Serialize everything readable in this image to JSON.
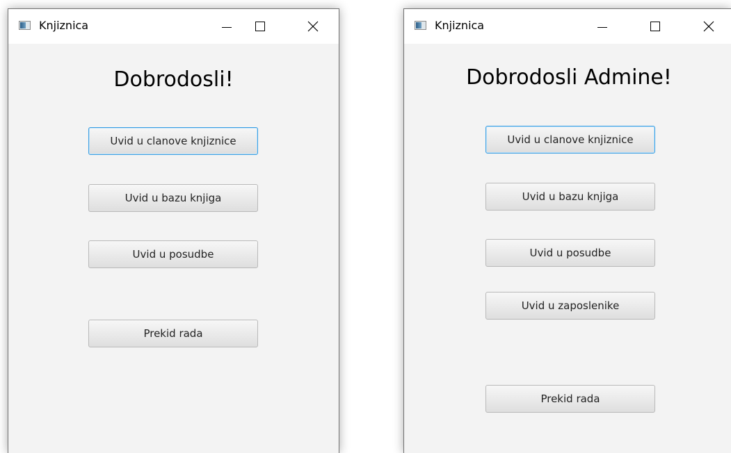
{
  "window_left": {
    "title": "Knjiznica",
    "heading": "Dobrodosli!",
    "buttons": [
      "Uvid u clanove knjiznice",
      "Uvid u bazu knjiga",
      "Uvid u posudbe",
      "Prekid rada"
    ]
  },
  "window_right": {
    "title": "Knjiznica",
    "heading": "Dobrodosli Admine!",
    "buttons": [
      "Uvid u clanove knjiznice",
      "Uvid u bazu knjiga",
      "Uvid u posudbe",
      "Uvid u zaposlenike",
      "Prekid rada"
    ]
  },
  "icons": {
    "app": "app-window-icon",
    "minimize": "minimize-icon",
    "maximize": "maximize-icon",
    "close": "close-icon"
  },
  "colors": {
    "focus_border": "#3b9fe3",
    "client_background": "#f3f3f3",
    "titlebar_background": "#ffffff"
  }
}
